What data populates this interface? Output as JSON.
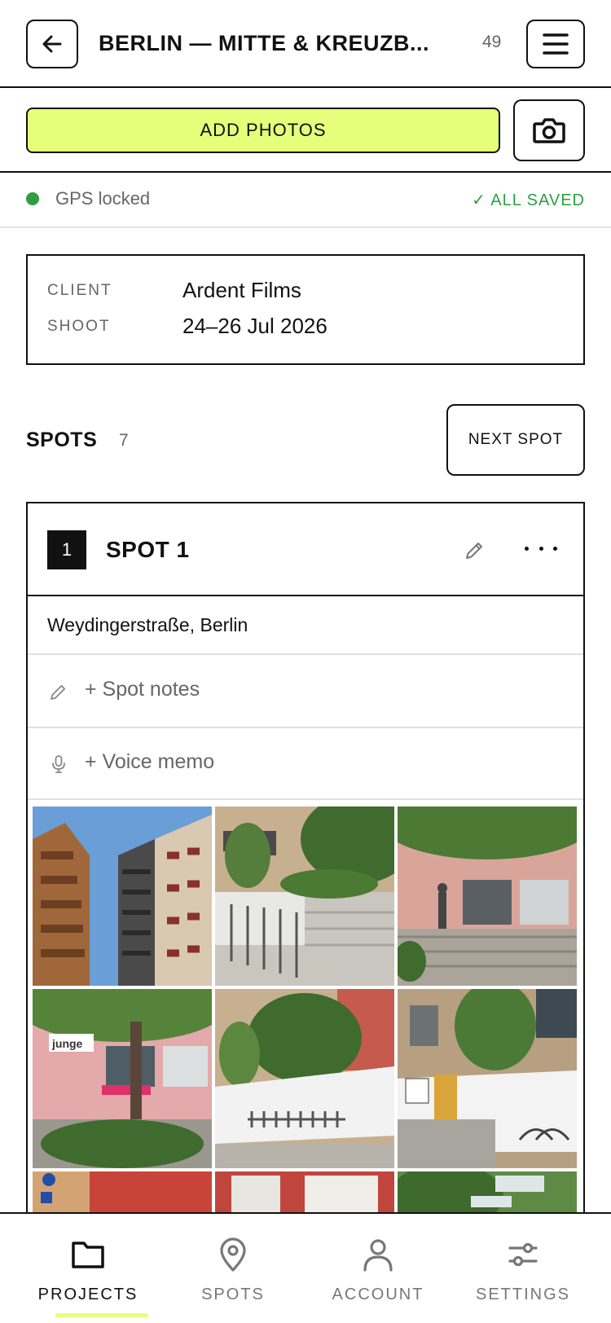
{
  "header": {
    "title": "BERLIN — MITTE & KREUZB...",
    "count": "49",
    "back_icon": "arrow-left-icon",
    "menu_icon": "hamburger-menu-icon"
  },
  "actions": {
    "add_photos_label": "ADD PHOTOS",
    "camera_icon": "camera-icon",
    "accent_color": "#e6ff7a"
  },
  "status": {
    "gps_text": "GPS locked",
    "saved_text": "✓ ALL SAVED",
    "status_color": "#2e9e3f"
  },
  "project_info": {
    "client_label": "CLIENT",
    "client_value": "Ardent Films",
    "shoot_label": "SHOOT",
    "shoot_value": "24–26 Jul 2026"
  },
  "spots": {
    "label": "SPOTS",
    "count": "7",
    "next_spot_label": "NEXT SPOT"
  },
  "spot_card": {
    "number": "1",
    "title": "SPOT 1",
    "address": "Weydingerstraße, Berlin",
    "notes_placeholder": "+ Spot notes",
    "voice_memo_placeholder": "+ Voice memo"
  },
  "bottom_nav": {
    "items": [
      {
        "label": "PROJECTS",
        "icon": "folder-icon",
        "active": true
      },
      {
        "label": "SPOTS",
        "icon": "map-pin-icon",
        "active": false
      },
      {
        "label": "ACCOUNT",
        "icon": "user-icon",
        "active": false
      },
      {
        "label": "SETTINGS",
        "icon": "sliders-icon",
        "active": false
      }
    ]
  }
}
